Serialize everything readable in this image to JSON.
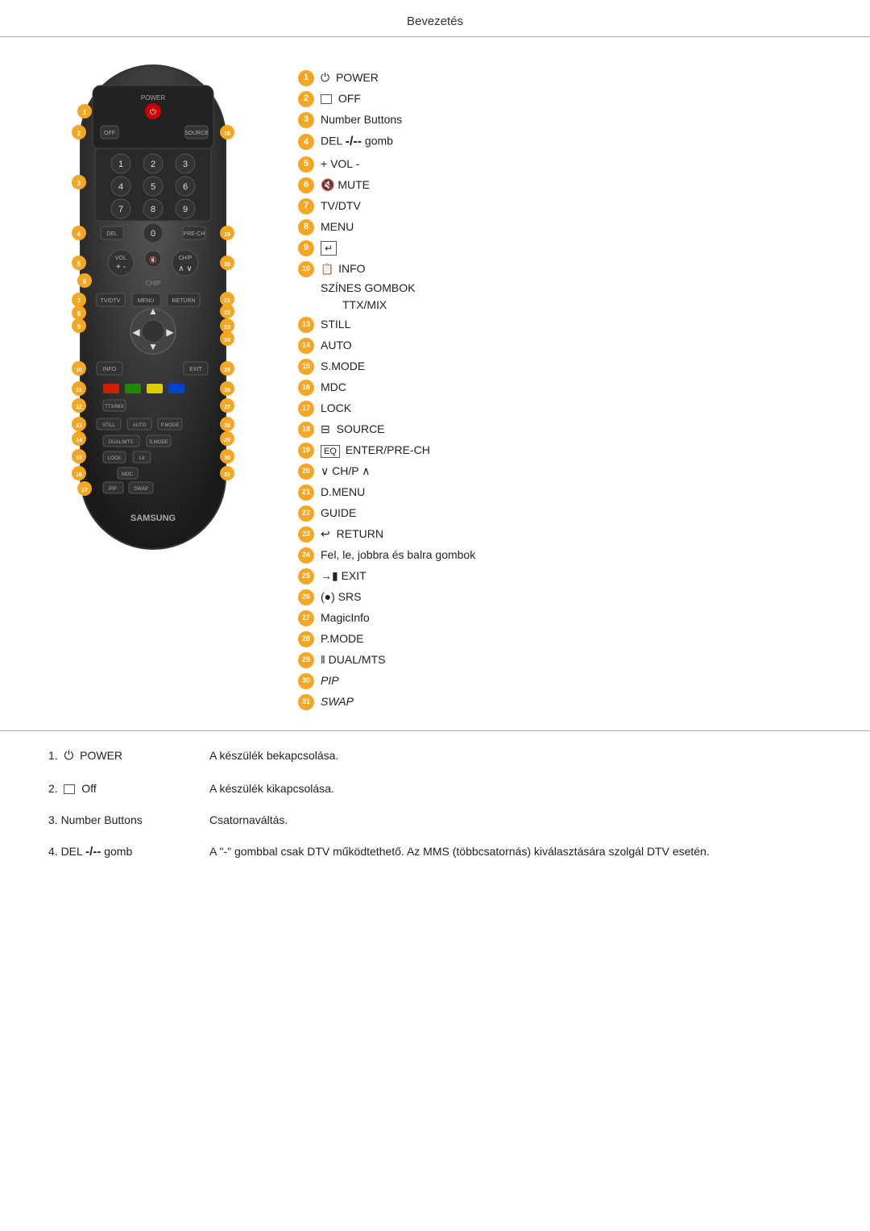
{
  "header": {
    "title": "Bevezetés"
  },
  "labels": [
    {
      "num": "1",
      "icon": "⏻",
      "text": "POWER"
    },
    {
      "num": "2",
      "icon": "□",
      "text": "OFF"
    },
    {
      "num": "3",
      "icon": "",
      "text": "Number Buttons"
    },
    {
      "num": "4",
      "icon": "",
      "text": "DEL -/-- gomb",
      "special": "del"
    },
    {
      "num": "5",
      "icon": "",
      "text": "+ VOL -"
    },
    {
      "num": "6",
      "icon": "🔇",
      "text": "MUTE"
    },
    {
      "num": "7",
      "icon": "",
      "text": "TV/DTV"
    },
    {
      "num": "8",
      "icon": "",
      "text": "MENU"
    },
    {
      "num": "9",
      "icon": "↵",
      "text": ""
    },
    {
      "num": "10",
      "icon": "",
      "text": "INFO",
      "special": "info"
    },
    {
      "num": "",
      "indent": true,
      "text": "SZÍNES GOMBOK"
    },
    {
      "num": "",
      "indent2": true,
      "text": "TTX/MIX"
    },
    {
      "num": "13",
      "icon": "",
      "text": "STILL"
    },
    {
      "num": "14",
      "icon": "",
      "text": "AUTO"
    },
    {
      "num": "15",
      "icon": "",
      "text": "S.MODE"
    },
    {
      "num": "16",
      "icon": "",
      "text": "MDC"
    },
    {
      "num": "17",
      "icon": "",
      "text": "LOCK"
    },
    {
      "num": "18",
      "icon": "⊟",
      "text": "SOURCE"
    },
    {
      "num": "19",
      "icon": "",
      "text": "ENTER/PRE-CH",
      "special": "enter"
    },
    {
      "num": "20",
      "icon": "",
      "text": "∨ CH/P ∧"
    },
    {
      "num": "21",
      "icon": "",
      "text": "D.MENU"
    },
    {
      "num": "22",
      "icon": "",
      "text": "GUIDE"
    },
    {
      "num": "23",
      "icon": "↩",
      "text": "RETURN"
    },
    {
      "num": "24",
      "icon": "",
      "text": "Fel, le, jobbra és balra gombok"
    },
    {
      "num": "25",
      "icon": "",
      "text": "→▪ EXIT"
    },
    {
      "num": "26",
      "icon": "",
      "text": "(●) SRS"
    },
    {
      "num": "27",
      "icon": "",
      "text": "MagicInfo"
    },
    {
      "num": "28",
      "icon": "",
      "text": "P.MODE"
    },
    {
      "num": "29",
      "icon": "",
      "text": "ǁ DUAL/MTS"
    },
    {
      "num": "30",
      "icon": "",
      "text": "PIP",
      "italic": true
    },
    {
      "num": "31",
      "icon": "",
      "text": "SWAP",
      "italic": true
    }
  ],
  "descriptions": [
    {
      "label": "1.  ⏻  POWER",
      "text": "A készülék bekapcsolása."
    },
    {
      "label": "2.  □  Off",
      "text": "A készülék kikapcsolása."
    },
    {
      "label": "3.  Number Buttons",
      "text": "Csatornaváltás."
    },
    {
      "label": "4.  DEL -/-- gomb",
      "text": "A \"-\" gombbal csak DTV működtethető. Az MMS (többcsatornás) kiválasztására szolgál DTV esetén."
    }
  ]
}
